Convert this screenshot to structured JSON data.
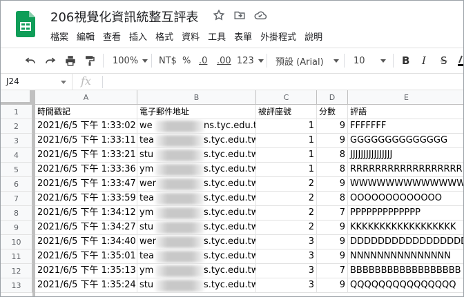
{
  "app": {
    "title": "206視覺化資訊統整互評表",
    "menu": [
      "檔案",
      "編輯",
      "查看",
      "插入",
      "格式",
      "資料",
      "工具",
      "表單",
      "外掛程式",
      "說明"
    ],
    "colors": {
      "sheets_green": "#0f9d58",
      "header_bg": "#f8f9fa",
      "grid_line": "#e2e2e2"
    }
  },
  "toolbar": {
    "zoom": "100%",
    "currency": "NT$",
    "percent": "%",
    "decrease_decimal": ".0",
    "increase_decimal": ".00",
    "more_formats": "123",
    "font": "預設 (Arial)",
    "font_size": "10",
    "bold": "B",
    "italic": "I",
    "strike": "S"
  },
  "formula_bar": {
    "cell_ref": "J24",
    "fx": "fx"
  },
  "grid": {
    "columns": [
      "A",
      "B",
      "C",
      "D",
      "E"
    ],
    "rows": [
      {
        "n": "1",
        "a": "時間戳記",
        "b1": "電子郵件地址",
        "b2": "",
        "c": "被評座號",
        "d": "分數",
        "e": "評語"
      },
      {
        "n": "2",
        "a": "2021/6/5 下午 1:33:02",
        "b1": "we",
        "b2": "ns.tyc.edu.tw",
        "c": "1",
        "d": "9",
        "e": "FFFFFFF"
      },
      {
        "n": "3",
        "a": "2021/6/5 下午 1:33:11",
        "b1": "tea",
        "b2": "s.tyc.edu.tw",
        "c": "1",
        "d": "9",
        "e": "GGGGGGGGGGGGGG"
      },
      {
        "n": "4",
        "a": "2021/6/5 下午 1:33:21",
        "b1": "stu",
        "b2": "s.tyc.edu.tw",
        "c": "1",
        "d": "8",
        "e": "JJJJJJJJJJJJJJJJ"
      },
      {
        "n": "5",
        "a": "2021/6/5 下午 1:33:36",
        "b1": "ym",
        "b2": "s.tyc.edu.tw",
        "c": "1",
        "d": "8",
        "e": "RRRRRRRRRRRRRRRRRR"
      },
      {
        "n": "6",
        "a": "2021/6/5 下午 1:33:47",
        "b1": "wer",
        "b2": "s.tyc.edu.tw",
        "c": "2",
        "d": "9",
        "e": "WWWWWWWWWWWWWW"
      },
      {
        "n": "7",
        "a": "2021/6/5 下午 1:33:59",
        "b1": "tea",
        "b2": "s.tyc.edu.tw",
        "c": "2",
        "d": "8",
        "e": "OOOOOOOOOOOOO"
      },
      {
        "n": "8",
        "a": "2021/6/5 下午 1:34:12",
        "b1": "ym",
        "b2": "s.tyc.edu.tw",
        "c": "2",
        "d": "7",
        "e": "PPPPPPPPPPPPP"
      },
      {
        "n": "9",
        "a": "2021/6/5 下午 1:34:27",
        "b1": "stu",
        "b2": "s.tyc.edu.tw",
        "c": "2",
        "d": "9",
        "e": "KKKKKKKKKKKKKKKKKK"
      },
      {
        "n": "10",
        "a": "2021/6/5 下午 1:34:40",
        "b1": "wer",
        "b2": "s.tyc.edu.tw",
        "c": "3",
        "d": "9",
        "e": "DDDDDDDDDDDDDDDDD"
      },
      {
        "n": "11",
        "a": "2021/6/5 下午 1:35:01",
        "b1": "tea",
        "b2": "s.tyc.edu.tw",
        "c": "3",
        "d": "9",
        "e": "NNNNNNNNNNNNNNN"
      },
      {
        "n": "12",
        "a": "2021/6/5 下午 1:35:13",
        "b1": "ym",
        "b2": "s.tyc.edu.tw",
        "c": "3",
        "d": "7",
        "e": "BBBBBBBBBBBBBBBBBB"
      },
      {
        "n": "13",
        "a": "2021/6/5 下午 1:35:24",
        "b1": "stu",
        "b2": "s.tyc.edu.tw",
        "c": "3",
        "d": "9",
        "e": "QQQQQQQQQQQQQQQ"
      }
    ]
  }
}
